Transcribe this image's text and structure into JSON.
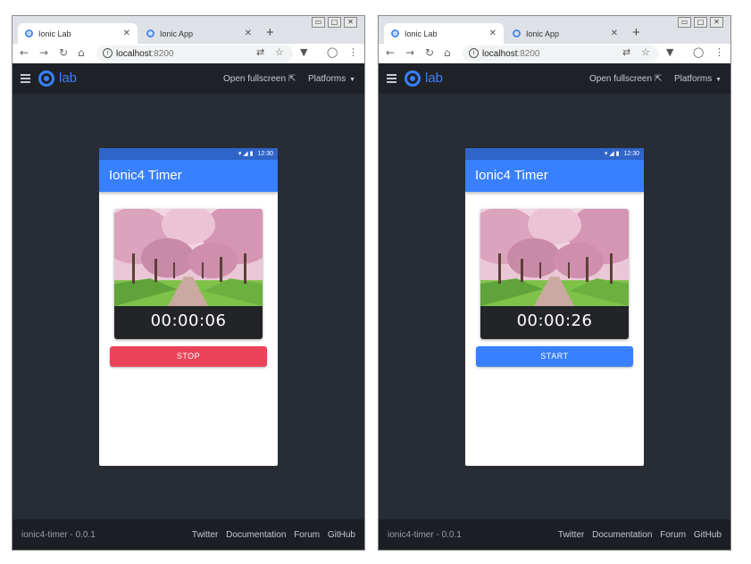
{
  "windows": [
    {
      "tabs": [
        {
          "title": "Ionic Lab",
          "active": true
        },
        {
          "title": "Ionic App",
          "active": false
        }
      ],
      "address": {
        "host": "localhost",
        "port": ":8200"
      },
      "lab": {
        "logo_text": "lab",
        "open_fullscreen": "Open fullscreen",
        "platforms": "Platforms"
      },
      "app": {
        "status_time": "12:30",
        "title": "Ionic4 Timer",
        "timer": "00:00:06",
        "button_label": "STOP",
        "button_color": "#eb445a"
      },
      "footer": {
        "project": "ionic4-timer - 0.0.1",
        "links": [
          "Twitter",
          "Documentation",
          "Forum",
          "GitHub"
        ]
      }
    },
    {
      "tabs": [
        {
          "title": "Ionic Lab",
          "active": true
        },
        {
          "title": "Ionic App",
          "active": false
        }
      ],
      "address": {
        "host": "localhost",
        "port": ":8200"
      },
      "lab": {
        "logo_text": "lab",
        "open_fullscreen": "Open fullscreen",
        "platforms": "Platforms"
      },
      "app": {
        "status_time": "12:30",
        "title": "Ionic4 Timer",
        "timer": "00:00:26",
        "button_label": "START",
        "button_color": "#3880ff"
      },
      "footer": {
        "project": "ionic4-timer - 0.0.1",
        "links": [
          "Twitter",
          "Documentation",
          "Forum",
          "GitHub"
        ]
      }
    }
  ],
  "icons": {
    "back": "back-arrow-icon",
    "forward": "forward-arrow-icon",
    "reload": "reload-icon",
    "home": "home-icon",
    "info": "info-icon",
    "translate": "translate-icon",
    "bookmark": "star-icon",
    "extension": "vpn-extension-icon",
    "profile": "profile-icon",
    "menu": "kebab-menu-icon",
    "hamburger": "hamburger-menu-icon",
    "external": "external-link-icon",
    "caret": "caret-down-icon"
  },
  "colors": {
    "ionic_primary": "#3880ff",
    "ionic_danger": "#eb445a",
    "lab_header": "#1e2227",
    "lab_stage": "#282c34"
  }
}
